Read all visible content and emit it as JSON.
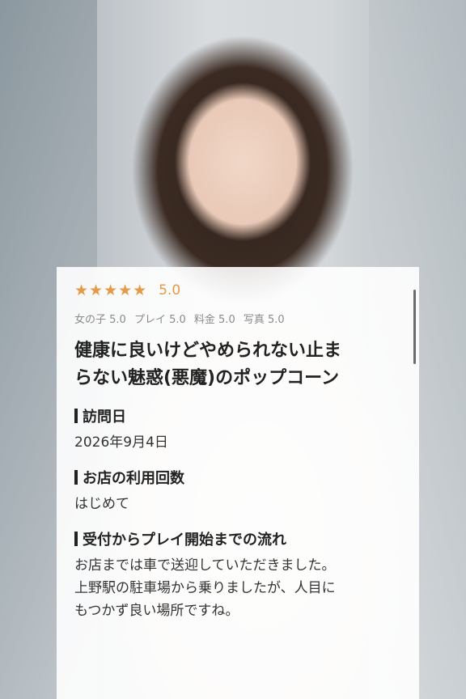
{
  "review": {
    "rating_value": "5.0",
    "subscores": {
      "girl": "女の子 5.0",
      "play": "プレイ 5.0",
      "price": "料金 5.0",
      "photo": "写真 5.0"
    },
    "title_line1": "健康に良いけどやめられない止ま",
    "title_line2": "らない魅惑(悪魔)のポップコーン",
    "sections": [
      {
        "label": "訪問日",
        "value": "2026年9月4日"
      },
      {
        "label": "お店の利用回数",
        "value": "はじめて"
      },
      {
        "label": "受付からプレイ開始までの流れ",
        "lines": [
          "お店までは車で送迎していただきました。",
          "上野駅の駐車場から乗りましたが、人目に",
          "もつかず良い場所ですね。"
        ]
      }
    ]
  },
  "colors": {
    "accent": "#e59a45"
  }
}
